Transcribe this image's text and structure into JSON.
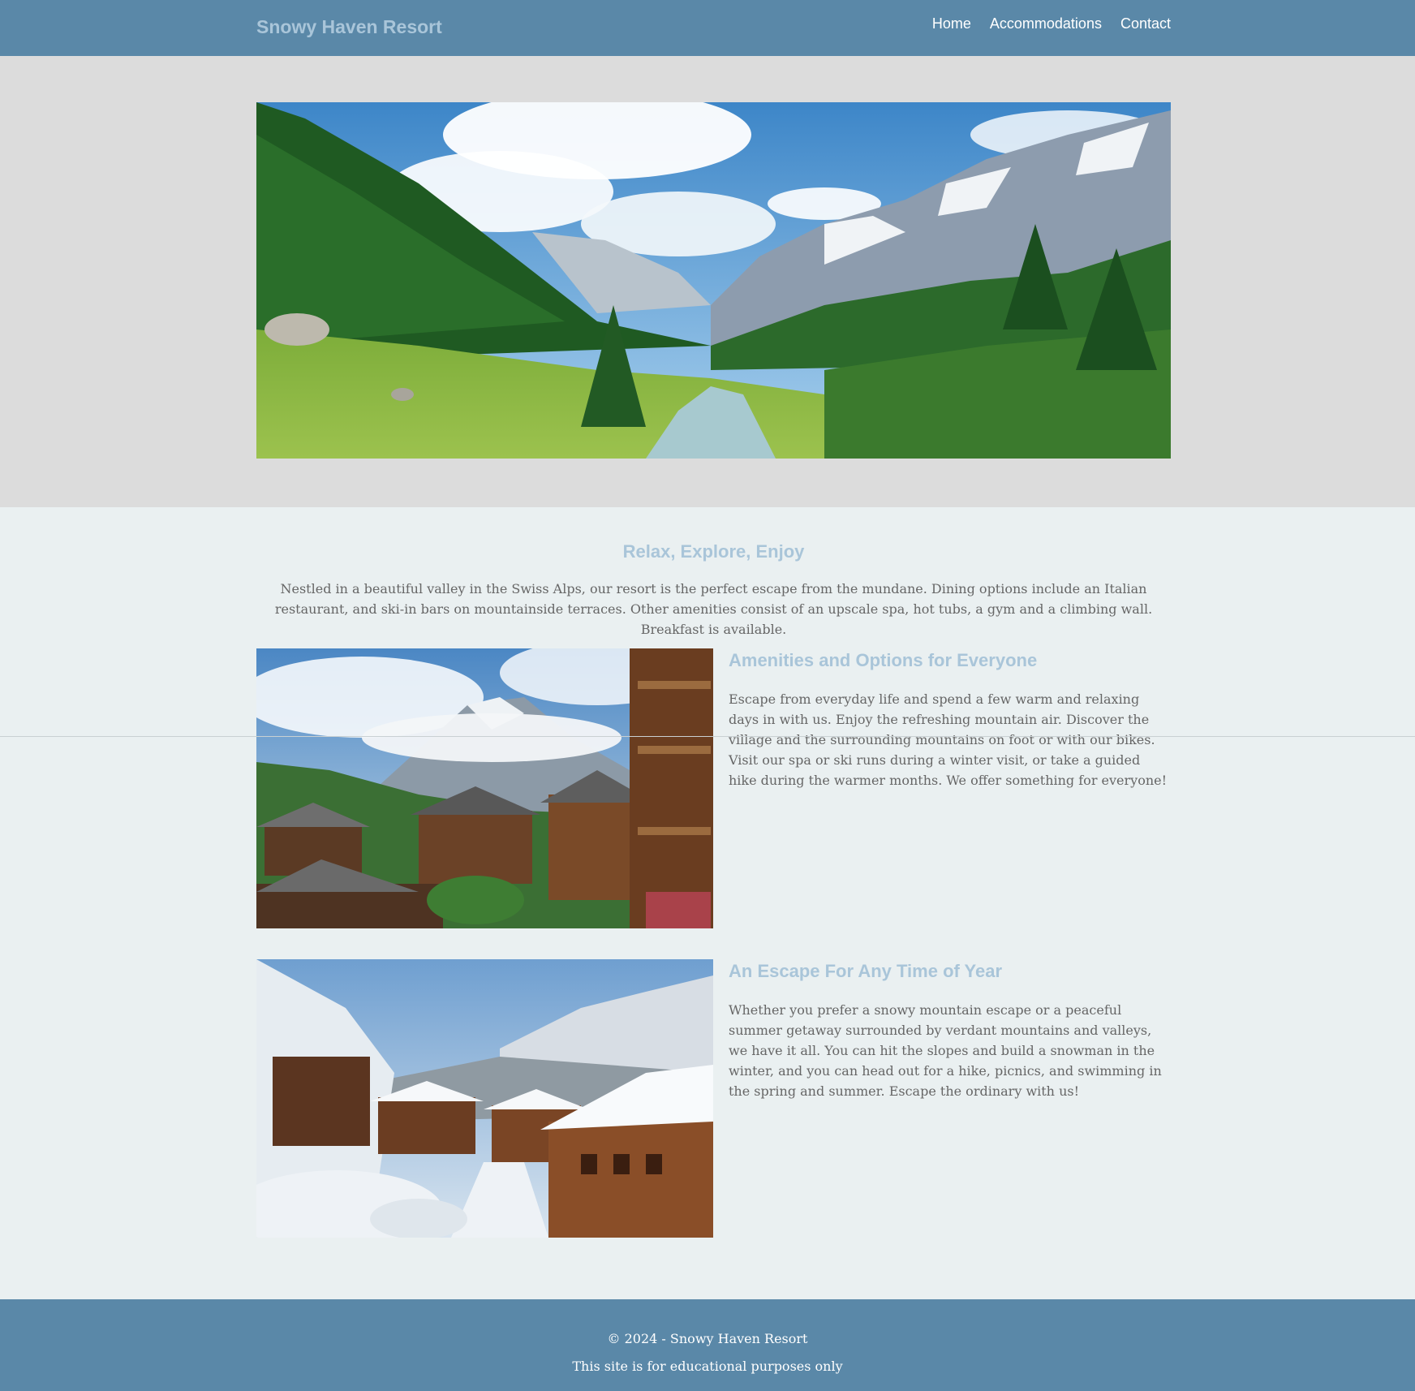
{
  "header": {
    "brand": "Snowy Haven Resort",
    "nav": [
      "Home",
      "Accommodations",
      "Contact"
    ]
  },
  "hero": {
    "image": "alpine-valley-with-pine-forest-river-and-snowy-peaks"
  },
  "intro": {
    "title": "Relax, Explore, Enjoy",
    "text": "Nestled in a beautiful valley in the Swiss Alps, our resort is the perfect escape from the mundane. Dining options include an Italian restaurant, and ski-in bars on mountainside terraces. Other amenities consist of an upscale spa, hot tubs, a gym and a climbing wall. Breakfast is available."
  },
  "features": [
    {
      "image": "summer-alpine-village-wooden-chalets",
      "title": "Amenities and Options for Everyone",
      "text": "Escape from everyday life and spend a few warm and relaxing days in with us. Enjoy the refreshing mountain air. Discover the village and the surrounding mountains on foot or with our bikes. Visit our spa or ski runs during a winter visit, or take a guided hike during the warmer months. We offer something for everyone!"
    },
    {
      "image": "snow-covered-alpine-village-winter",
      "title": "An Escape For Any Time of Year",
      "text": "Whether you prefer a snowy mountain escape or a peaceful summer getaway surrounded by verdant mountains and valleys, we have it all. You can hit the slopes and build a snowman in the winter, and you can head out for a hike, picnics, and swimming in the spring and summer. Escape the ordinary with us!"
    }
  ],
  "footer": {
    "copyright": "© 2024 - Snowy Haven Resort",
    "note": "This site is for educational purposes only"
  },
  "colors": {
    "header_bg": "#5a88a8",
    "heading": "#a9c5d9",
    "page_bg": "#eaf0f1",
    "hero_band": "#dcdcdc"
  }
}
